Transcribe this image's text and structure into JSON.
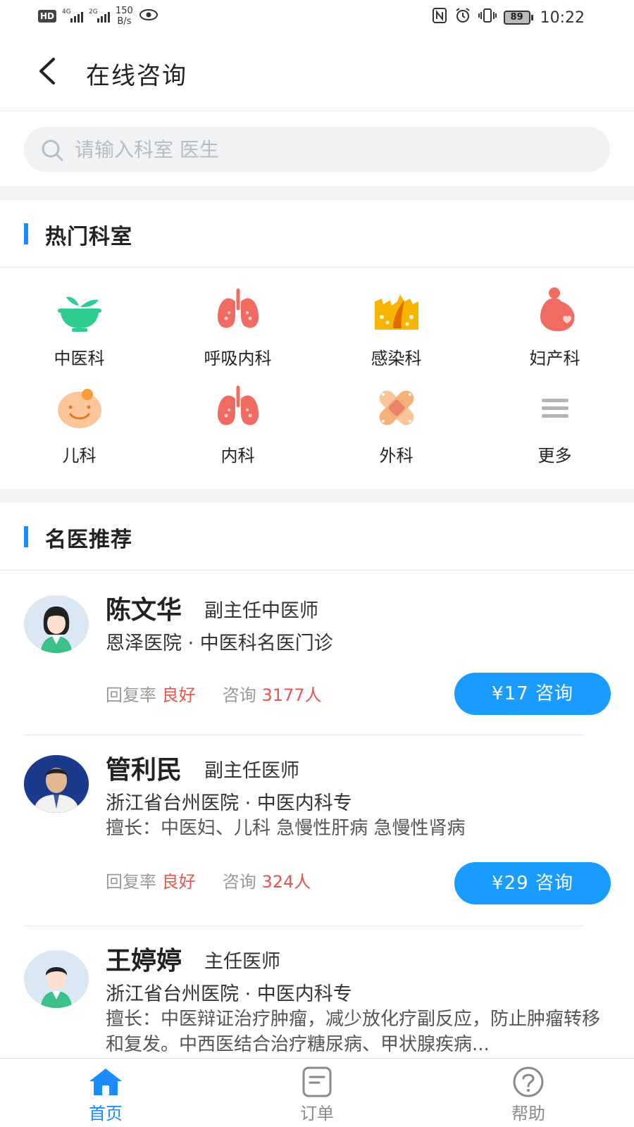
{
  "status_bar": {
    "hd": "HD",
    "net1": "4G",
    "net2": "2G",
    "speed_value": "150",
    "speed_unit": "B/s",
    "battery": "89",
    "time": "10:22"
  },
  "header": {
    "title": "在线咨询"
  },
  "search": {
    "placeholder": "请输入科室 医生"
  },
  "departments": {
    "title": "热门科室",
    "items": [
      {
        "label": "中医科",
        "icon": "herbal-bowl-icon"
      },
      {
        "label": "呼吸内科",
        "icon": "lungs-icon"
      },
      {
        "label": "感染科",
        "icon": "infection-icon"
      },
      {
        "label": "妇产科",
        "icon": "pregnant-icon"
      },
      {
        "label": "儿科",
        "icon": "baby-icon"
      },
      {
        "label": "内科",
        "icon": "lungs-icon"
      },
      {
        "label": "外科",
        "icon": "bandage-icon"
      },
      {
        "label": "更多",
        "icon": "menu-icon"
      }
    ]
  },
  "doctors": {
    "title": "名医推荐",
    "items": [
      {
        "name": "陈文华",
        "title": "副主任中医师",
        "hospital": "恩泽医院 · 中医科名医门诊",
        "skill": "",
        "reply_label": "回复率",
        "reply_value": "良好",
        "consult_label": "咨询",
        "consult_count": "3177人",
        "button": "¥17 咨询",
        "avatar": "female-doctor-avatar"
      },
      {
        "name": "管利民",
        "title": "副主任医师",
        "hospital": "浙江省台州医院 · 中医内科专",
        "skill": "擅长：中医妇、儿科 急慢性肝病 急慢性肾病",
        "reply_label": "回复率",
        "reply_value": "良好",
        "consult_label": "咨询",
        "consult_count": "324人",
        "button": "¥29 咨询",
        "avatar": "doctor-photo"
      },
      {
        "name": "王婷婷",
        "title": "主任医师",
        "hospital": "浙江省台州医院 · 中医内科专",
        "skill": "擅长：中医辩证治疗肿瘤，减少放化疗副反应，防止肿瘤转移和复发。中西医结合治疗糖尿病、甲状腺疾病...",
        "avatar": "male-doctor-avatar"
      }
    ]
  },
  "tabs": [
    {
      "label": "首页",
      "icon": "home-icon",
      "active": true
    },
    {
      "label": "订单",
      "icon": "order-icon",
      "active": false
    },
    {
      "label": "帮助",
      "icon": "help-icon",
      "active": false
    }
  ],
  "colors": {
    "accent": "#1a8cff",
    "button": "#1a9bff",
    "highlight": "#e8554d",
    "gap": "#f2f3f5"
  }
}
